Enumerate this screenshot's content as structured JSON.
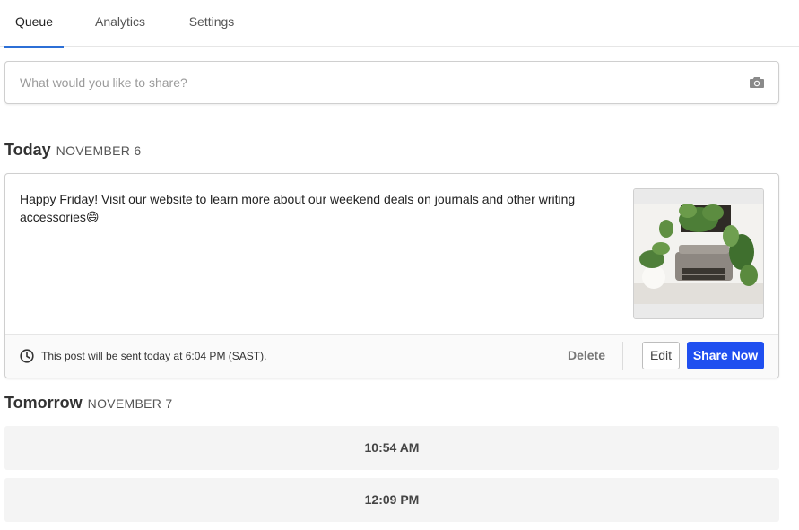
{
  "tabs": [
    {
      "label": "Queue",
      "active": true
    },
    {
      "label": "Analytics",
      "active": false
    },
    {
      "label": "Settings",
      "active": false
    }
  ],
  "composer": {
    "placeholder": "What would you like to share?",
    "icon": "camera-icon"
  },
  "today": {
    "heading": "Today",
    "date": "NOVEMBER 6",
    "post": {
      "text": "Happy Friday! Visit our website to learn more about our weekend deals on journals and other writing accessories😄",
      "image_alt": "typewriter with plants",
      "schedule": "This post will be sent today at 6:04 PM (SAST).",
      "delete_label": "Delete",
      "edit_label": "Edit",
      "share_label": "Share Now"
    }
  },
  "tomorrow": {
    "heading": "Tomorrow",
    "date": "NOVEMBER 7",
    "slots": [
      "10:54 AM",
      "12:09 PM"
    ]
  },
  "colors": {
    "accent": "#1f4ff0",
    "tab_underline": "#2c6fd6"
  }
}
